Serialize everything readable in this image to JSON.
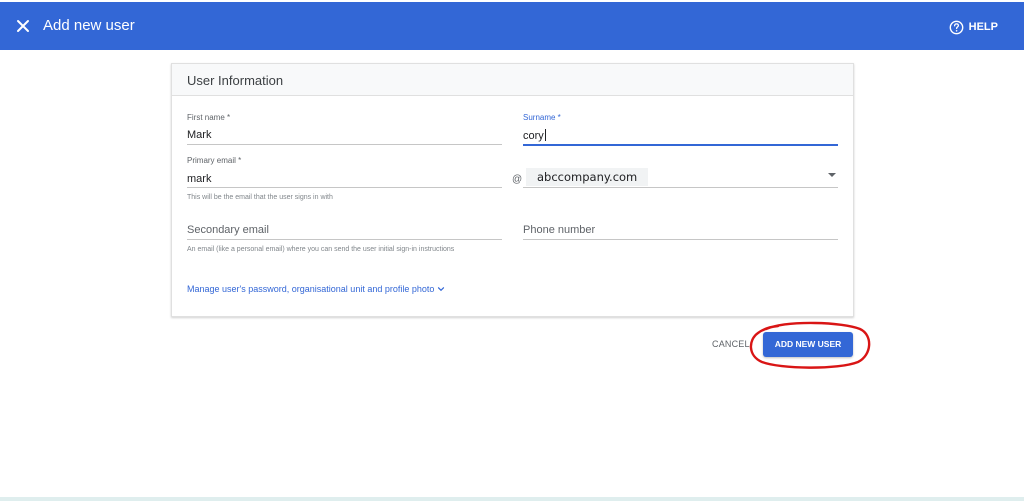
{
  "header": {
    "title": "Add new user",
    "help_label": "HELP",
    "background_color": "#3367d6"
  },
  "card": {
    "title": "User Information",
    "first_name": {
      "label": "First name *",
      "value": "Mark"
    },
    "surname": {
      "label": "Surname *",
      "value": "cory"
    },
    "primary_email": {
      "label": "Primary email *",
      "value": "mark",
      "at": "@",
      "domain": "abccompany.com",
      "hint": "This will be the email that the user signs in with"
    },
    "secondary_email": {
      "placeholder": "Secondary email",
      "hint": "An email (like a personal email) where you can send the user initial sign-in instructions"
    },
    "phone": {
      "placeholder": "Phone number"
    },
    "manage_link": "Manage user's password, organisational unit and profile photo"
  },
  "actions": {
    "cancel_label": "CANCEL",
    "add_label": "ADD NEW USER",
    "highlight_color": "#d91515"
  },
  "icons": {
    "close": "close-icon",
    "help": "help-circle-icon",
    "expand": "chevron-down-icon",
    "dropdown": "dropdown-arrow-icon"
  }
}
